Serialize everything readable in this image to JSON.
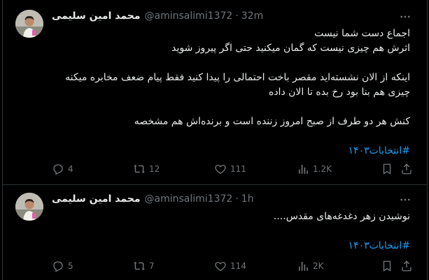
{
  "tweets": [
    {
      "author_name": "محمد امین سلیمی",
      "handle": "@aminsalimi1372",
      "separator": "·",
      "time": "32m",
      "lines": [
        "اجماع دست شما نیست",
        "اثرش هم چیزی نیست که گمان میکنید حتی اگر پیروز شوید",
        "",
        "اینکه از الان نشسته‌اید مقصر باخت احتمالی را پیدا کنید فقط پیام ضعف مخابره میکنه",
        "چیزی هم بنا بود رخ بده تا الان داده",
        "",
        "کنش هر دو طرف از صبح امروز زننده است و برنده‌اش هم مشخصه",
        ""
      ],
      "hashtag": "#انتخابات۱۴۰۳",
      "replies": "4",
      "reposts": "12",
      "likes": "111",
      "views": "1.2K"
    },
    {
      "author_name": "محمد امین سلیمی",
      "handle": "@aminsalimi1372",
      "separator": "·",
      "time": "1h",
      "lines": [
        "نوشیدن زهر دغدغه‌های مقدس....",
        ""
      ],
      "hashtag": "#انتخابات۱۴۰۳",
      "replies": "5",
      "reposts": "7",
      "likes": "114",
      "views": "2K"
    }
  ],
  "icons": {
    "reply": "reply-icon",
    "repost": "repost-icon",
    "like": "like-icon",
    "views": "views-icon",
    "bookmark": "bookmark-icon",
    "share": "share-icon",
    "more": "more-icon"
  },
  "colors": {
    "background": "#000000",
    "text": "#e7e9ea",
    "muted": "#71767b",
    "link": "#1d9bf0",
    "border": "#2f3336"
  }
}
